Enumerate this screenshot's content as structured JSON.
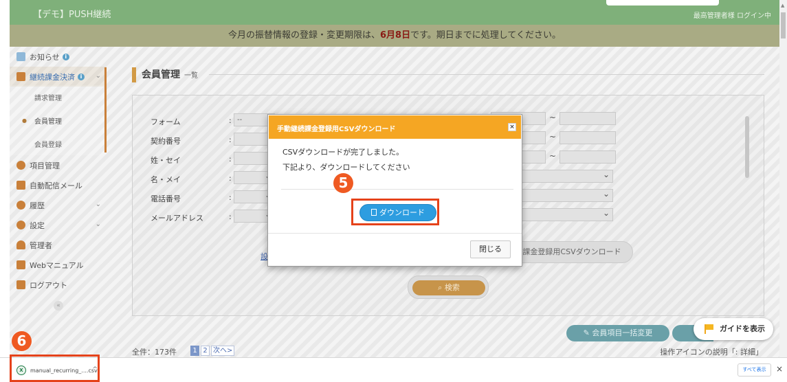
{
  "header": {
    "brand": "【デモ】PUSH継続",
    "login_status": "最高管理者様 ログイン中"
  },
  "notice": {
    "before": "今月の振替情報の登録・変更期限は、",
    "deadline": "6月8日",
    "after": "です。期日までに処理してください。"
  },
  "sidebar": {
    "items": [
      {
        "label": "お知らせ",
        "icon": "chart-icon"
      },
      {
        "label": "継続課金決済",
        "icon": "card-icon"
      },
      {
        "label": "項目管理",
        "icon": "cubes-icon"
      },
      {
        "label": "自動配信メール",
        "icon": "mail-icon"
      },
      {
        "label": "履歴",
        "icon": "history-icon"
      },
      {
        "label": "設定",
        "icon": "gear-icon"
      },
      {
        "label": "管理者",
        "icon": "user-icon"
      },
      {
        "label": "Webマニュアル",
        "icon": "book-icon"
      },
      {
        "label": "ログアウト",
        "icon": "logout-icon"
      }
    ],
    "subitems": [
      {
        "label": "請求管理"
      },
      {
        "label": "会員管理"
      },
      {
        "label": "会員登録"
      }
    ]
  },
  "main": {
    "title": "会員管理",
    "subtitle": "一覧",
    "form": {
      "labels": [
        "フォーム",
        "契約番号",
        "姓・セイ",
        "名・メイ",
        "電話番号",
        "メールアドレス"
      ],
      "colon": ":",
      "form_select_value": "--",
      "tilde": "~"
    },
    "link_fragment": "設",
    "csv_button": "課金登録用CSVダウンロード",
    "search_button": "検索",
    "bulk_button": "会員項目一括変更",
    "count": "全件：173件",
    "pager": [
      "1",
      "2",
      "次へ>"
    ],
    "icon_help": "操作アイコンの説明「: 詳細」"
  },
  "guide": {
    "label": "ガイドを表示"
  },
  "modal": {
    "title": "手動継続課金登録用CSVダウンロード",
    "close_glyph": "×",
    "message1": "CSVダウンロードが完了しました。",
    "message2": "下記より、ダウンロードしてください",
    "download_button": "ダウンロード",
    "close_button": "閉じる"
  },
  "steps": {
    "step5": "5",
    "step6": "6"
  },
  "download_bar": {
    "filename": "manual_recurring_....csv",
    "file_icon": "excel-icon",
    "show_all": "すべて表示",
    "close_glyph": "×"
  },
  "colors": {
    "header": "#7fb07a",
    "modal_header": "#f5a623",
    "download_button": "#2d9de0",
    "highlight": "#e5421a",
    "step_badge": "#ef5a22"
  }
}
